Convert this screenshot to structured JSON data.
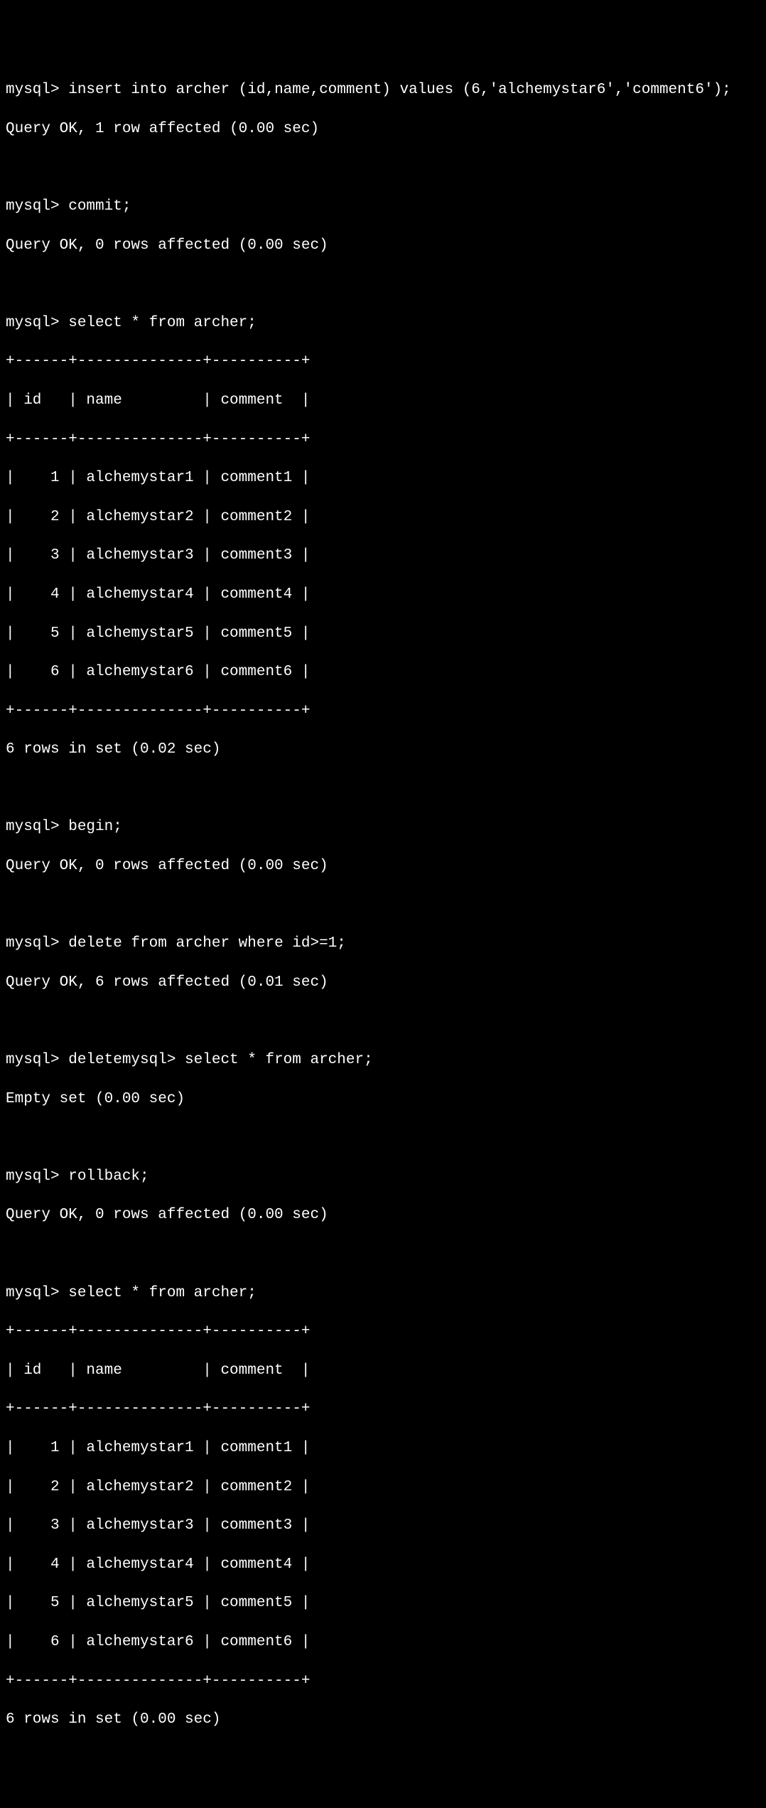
{
  "prompt": "mysql> ",
  "commands": {
    "insert": "insert into archer (id,name,comment) values (6,'alchemystar6','comment6');",
    "commit": "commit;",
    "select1": "select * from archer;",
    "begin": "begin;",
    "delete": "delete from archer where id>=1;",
    "deletemysql_select": "deletemysql> select * from archer;",
    "rollback": "rollback;",
    "select2": "select * from archer;"
  },
  "responses": {
    "insert_ok": "Query OK, 1 row affected (0.00 sec)",
    "commit_ok": "Query OK, 0 rows affected (0.00 sec)",
    "begin_ok": "Query OK, 0 rows affected (0.00 sec)",
    "delete_ok": "Query OK, 6 rows affected (0.01 sec)",
    "empty_set": "Empty set (0.00 sec)",
    "rollback_ok": "Query OK, 0 rows affected (0.00 sec)",
    "rows1": "6 rows in set (0.02 sec)",
    "rows2": "6 rows in set (0.00 sec)"
  },
  "table": {
    "border": "+------+--------------+----------+",
    "header": "| id   | name         | comment  |",
    "rows": [
      "|    1 | alchemystar1 | comment1 |",
      "|    2 | alchemystar2 | comment2 |",
      "|    3 | alchemystar3 | comment3 |",
      "|    4 | alchemystar4 | comment4 |",
      "|    5 | alchemystar5 | comment5 |",
      "|    6 | alchemystar6 | comment6 |"
    ]
  }
}
